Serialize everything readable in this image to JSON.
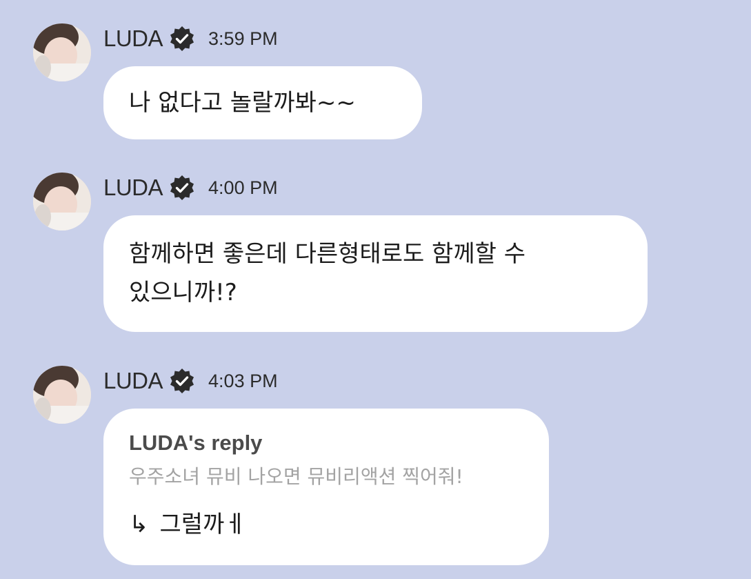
{
  "messages": [
    {
      "sender": "LUDA",
      "time": "3:59 PM",
      "text": "나 없다고 놀랄까봐~~"
    },
    {
      "sender": "LUDA",
      "time": "4:00 PM",
      "line1": "함께하면 좋은데 다른형태로도 함께할 수",
      "line2": "있으니까!?"
    },
    {
      "sender": "LUDA",
      "time": "4:03 PM",
      "reply_title": "LUDA's reply",
      "reply_quote": "우주소녀 뮤비 나오면 뮤비리액션 찍어줘!",
      "reply_arrow": "↳",
      "reply_text": "그럴까ㅔ"
    }
  ],
  "icons": {
    "verified": "verified-badge-icon"
  },
  "colors": {
    "background": "#c9d0ea",
    "bubble": "#ffffff",
    "text": "#1c1c1c",
    "quote": "#a3a3a3"
  }
}
